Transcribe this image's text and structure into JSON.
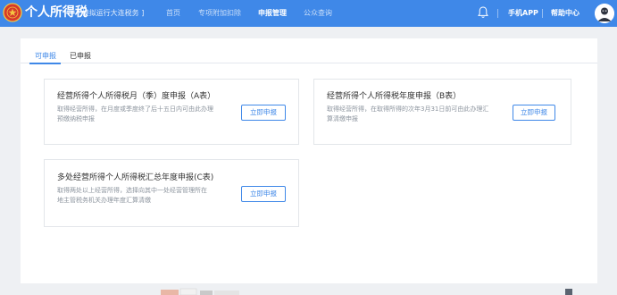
{
  "header": {
    "brand_title": "个人所得税",
    "brand_tag": "[ 模拟运行大连税务 ]",
    "nav": [
      "首页",
      "专项附加扣除",
      "申报管理",
      "公众查询"
    ],
    "active_nav": "申报管理",
    "mobile_app": "手机APP",
    "help_center": "帮助中心",
    "icons": {
      "logo": "tax-emblem-icon",
      "notification": "bell-icon",
      "user": "avatar-icon"
    }
  },
  "tabs": [
    {
      "label": "可申报",
      "active": true
    },
    {
      "label": "已申报",
      "active": false
    }
  ],
  "cards": [
    {
      "title": "经营所得个人所得税月（季）度申报（A表）",
      "desc_line1": "取得经营所得，在月度或季度终了后十五日内可由此办理",
      "desc_line2": "预缴纳税申报",
      "button": "立即申报"
    },
    {
      "title": "经营所得个人所得税年度申报（B表）",
      "desc_line1": "取得经营所得，在取得所得的次年3月31日前可由此办理汇",
      "desc_line2": "算清缴申报",
      "button": "立即申报"
    },
    {
      "title": "多处经营所得个人所得税汇总年度申报(C表)",
      "desc_line1": "取得两处以上经营所得，选择向其中一处经营管理所在",
      "desc_line2": "地主管税务机关办理年度汇算清缴",
      "button": "立即申报"
    }
  ],
  "colors": {
    "header_bg": "#3f88e8",
    "accent": "#3f88e8",
    "page_bg": "#eef0f3",
    "card_border": "#e3e6ea"
  }
}
